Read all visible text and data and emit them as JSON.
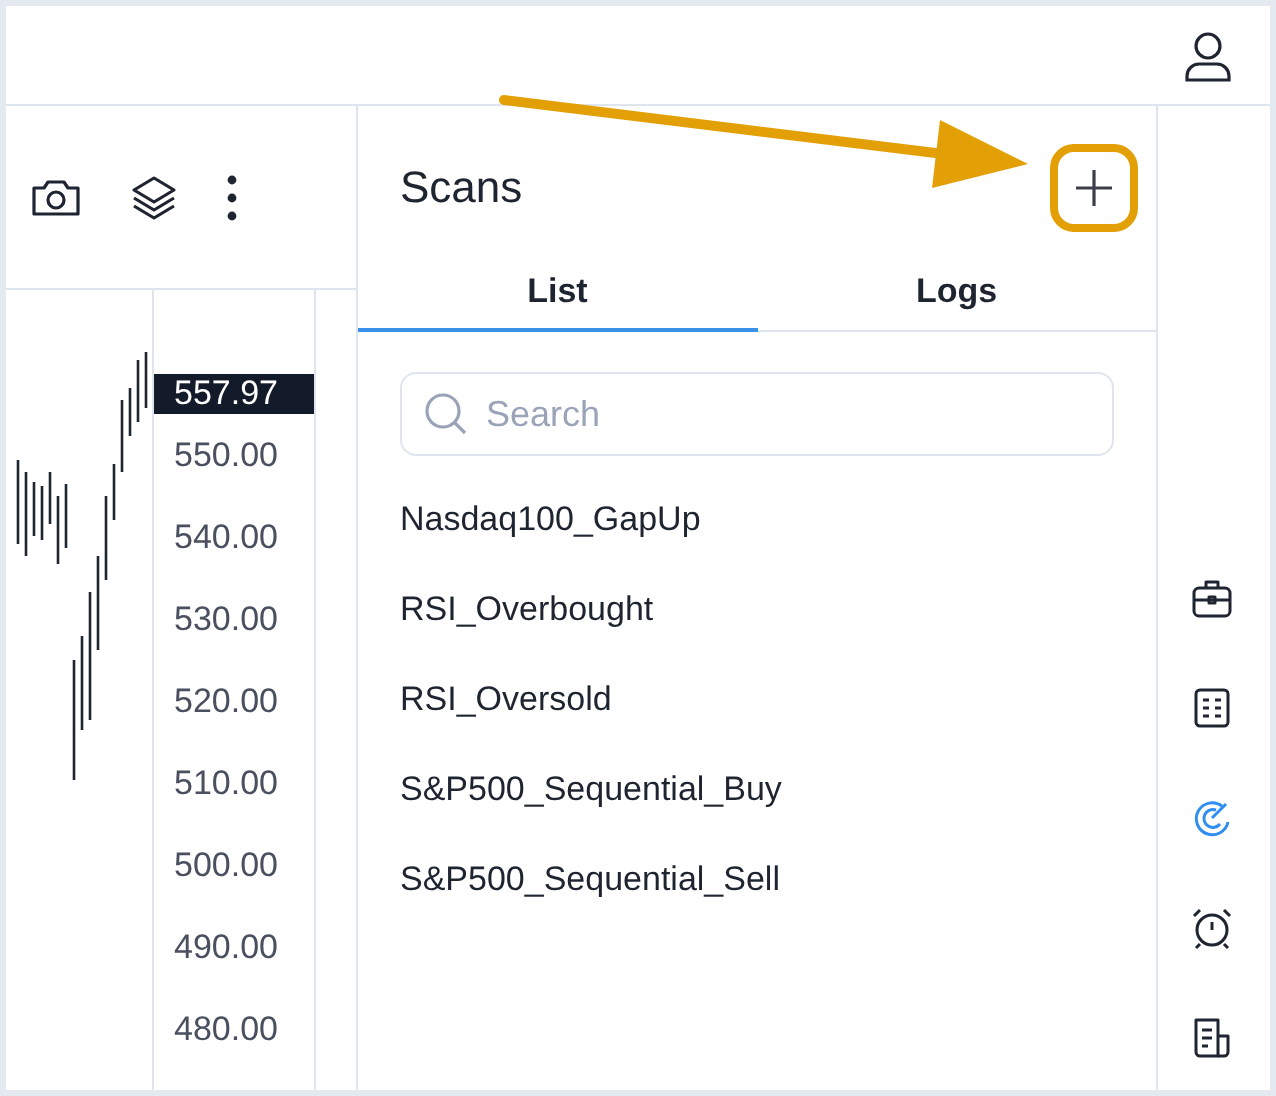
{
  "chart_toolbar": [
    {
      "kind": "camera"
    },
    {
      "kind": "layers"
    },
    {
      "kind": "more"
    }
  ],
  "price_axis": {
    "labels": [
      "550.00",
      "540.00",
      "530.00",
      "520.00",
      "510.00",
      "500.00",
      "490.00",
      "480.00"
    ],
    "last_price": "557.97"
  },
  "panel": {
    "title": "Scans",
    "add_button": {
      "highlighted": true
    },
    "tabs": [
      {
        "label": "List",
        "selected": true
      },
      {
        "label": "Logs",
        "selected": false
      }
    ],
    "search": {
      "placeholder": "Search"
    },
    "scans": [
      "Nasdaq100_GapUp",
      "RSI_Overbought",
      "RSI_Oversold",
      "S&P500_Sequential_Buy",
      "S&P500_Sequential_Sell"
    ]
  },
  "rail": [
    {
      "kind": "briefcase",
      "selected": false
    },
    {
      "kind": "table",
      "selected": false
    },
    {
      "kind": "scanner",
      "selected": true
    },
    {
      "kind": "alarm",
      "selected": false
    },
    {
      "kind": "news",
      "selected": false
    }
  ]
}
